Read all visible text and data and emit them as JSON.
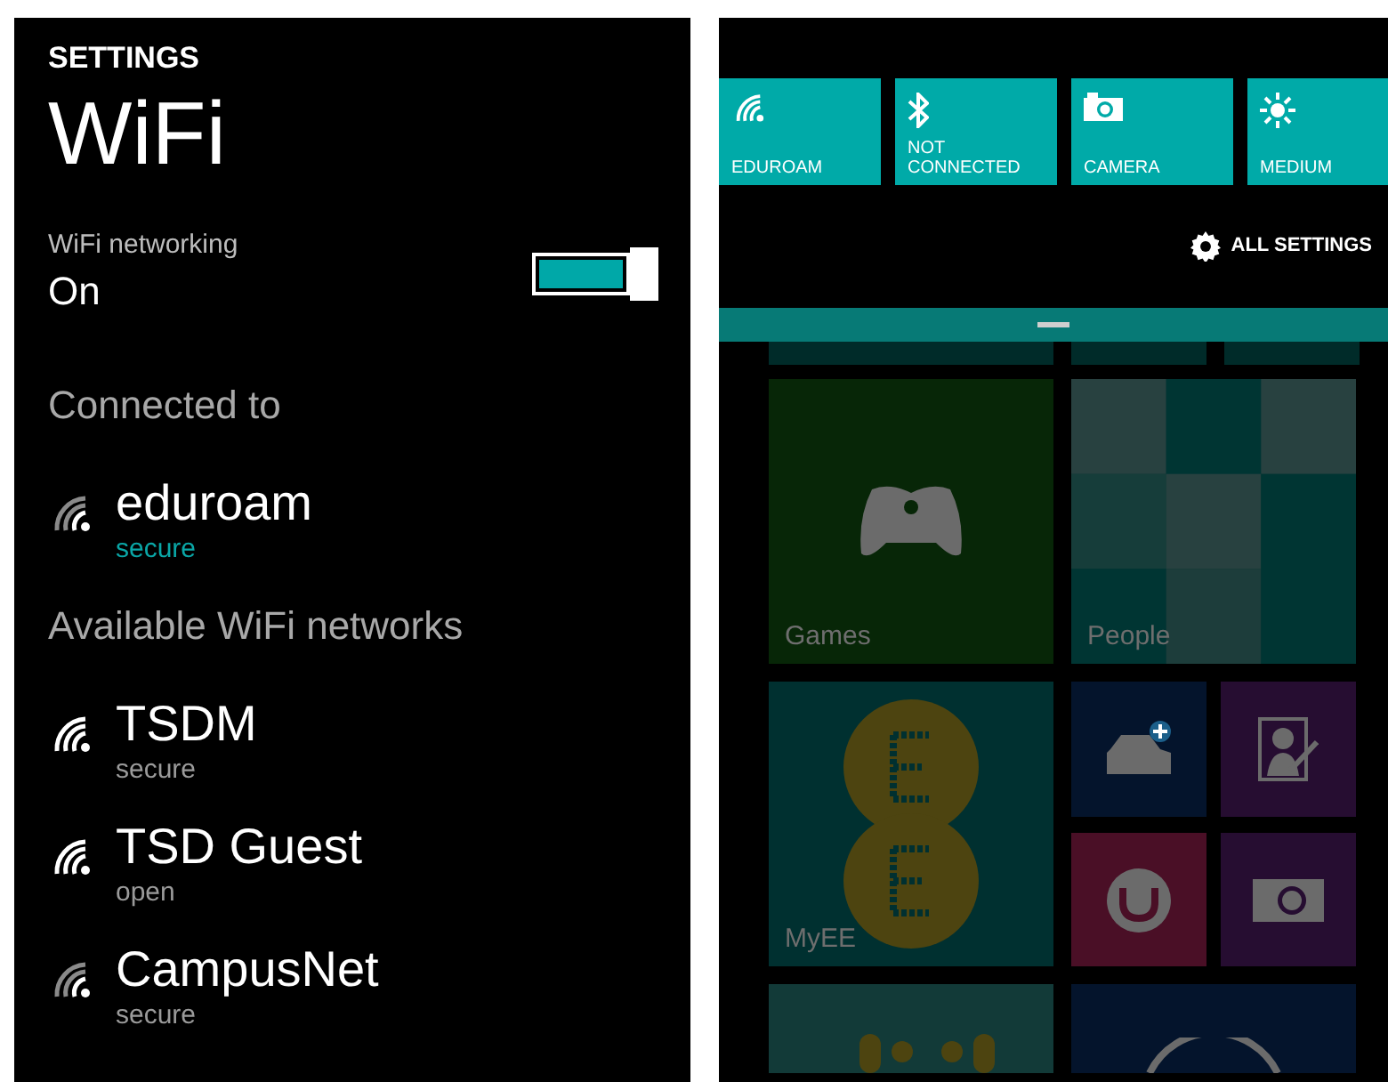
{
  "settings": {
    "app_title": "SETTINGS",
    "page_title": "WiFi",
    "wifi_networking": {
      "label": "WiFi networking",
      "value": "On",
      "on": true
    },
    "connected_heading": "Connected to",
    "connected": [
      {
        "name": "eduroam",
        "security": "secure"
      }
    ],
    "available_heading": "Available WiFi networks",
    "available": [
      {
        "name": "TSDM",
        "security": "secure"
      },
      {
        "name": "TSD Guest",
        "security": "open"
      },
      {
        "name": "CampusNet",
        "security": "secure"
      }
    ]
  },
  "action_center": {
    "quick_actions": [
      {
        "kind": "wifi",
        "label": "EDUROAM"
      },
      {
        "kind": "bluetooth",
        "label": "NOT CONNECTED"
      },
      {
        "kind": "camera",
        "label": "CAMERA"
      },
      {
        "kind": "brightness",
        "label": "MEDIUM"
      }
    ],
    "all_settings": "ALL SETTINGS"
  },
  "start_screen": {
    "top_tiles": [
      {
        "color": "#002b29"
      },
      {
        "color": "#002b29"
      },
      {
        "color": "#002b29"
      }
    ],
    "tiles": [
      {
        "kind": "games",
        "label": "Games",
        "color": "#072607"
      },
      {
        "kind": "people",
        "label": "People",
        "color": "#003533"
      },
      {
        "kind": "myee",
        "label": "MyEE",
        "color": "#003030"
      },
      {
        "kind": "car",
        "color": "#04142c"
      },
      {
        "kind": "photo-edit",
        "color": "#260d31"
      },
      {
        "kind": "smile",
        "color": "#4a0f26"
      },
      {
        "kind": "camera",
        "color": "#260d31"
      },
      {
        "kind": "bars",
        "color": "#123a38"
      },
      {
        "kind": "ring",
        "color": "#04142c"
      }
    ]
  }
}
